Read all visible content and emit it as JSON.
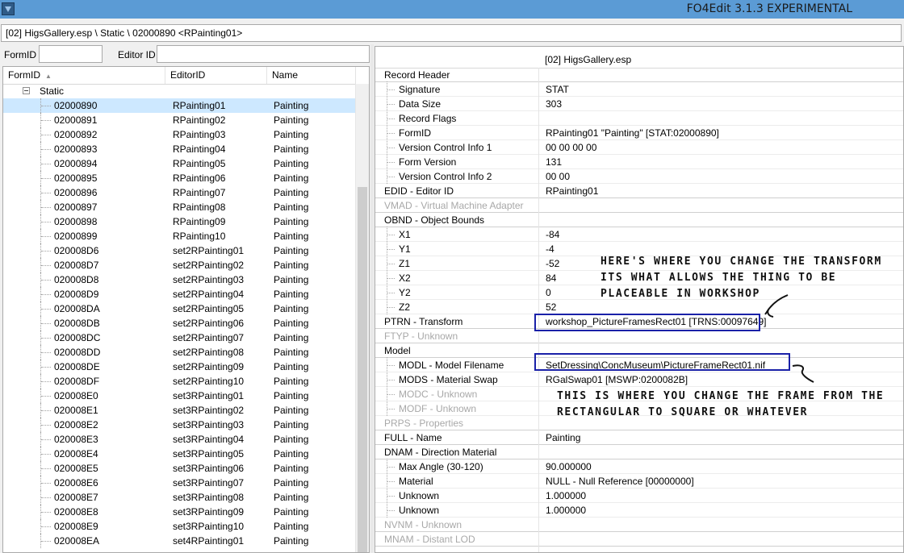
{
  "window": {
    "title": "FO4Edit 3.1.3 EXPERIMENTAL"
  },
  "path": "[02] HigsGallery.esp \\ Static \\ 02000890 <RPainting01>",
  "filter": {
    "formid_label": "FormID",
    "formid_value": "",
    "editorid_label": "Editor ID",
    "editorid_value": ""
  },
  "list": {
    "columns": [
      "FormID",
      "EditorID",
      "Name"
    ],
    "group": "Static",
    "rows": [
      [
        "02000890",
        "RPainting01",
        "Painting"
      ],
      [
        "02000891",
        "RPainting02",
        "Painting"
      ],
      [
        "02000892",
        "RPainting03",
        "Painting"
      ],
      [
        "02000893",
        "RPainting04",
        "Painting"
      ],
      [
        "02000894",
        "RPainting05",
        "Painting"
      ],
      [
        "02000895",
        "RPainting06",
        "Painting"
      ],
      [
        "02000896",
        "RPainting07",
        "Painting"
      ],
      [
        "02000897",
        "RPainting08",
        "Painting"
      ],
      [
        "02000898",
        "RPainting09",
        "Painting"
      ],
      [
        "02000899",
        "RPainting10",
        "Painting"
      ],
      [
        "020008D6",
        "set2RPainting01",
        "Painting"
      ],
      [
        "020008D7",
        "set2RPainting02",
        "Painting"
      ],
      [
        "020008D8",
        "set2RPainting03",
        "Painting"
      ],
      [
        "020008D9",
        "set2RPainting04",
        "Painting"
      ],
      [
        "020008DA",
        "set2RPainting05",
        "Painting"
      ],
      [
        "020008DB",
        "set2RPainting06",
        "Painting"
      ],
      [
        "020008DC",
        "set2RPainting07",
        "Painting"
      ],
      [
        "020008DD",
        "set2RPainting08",
        "Painting"
      ],
      [
        "020008DE",
        "set2RPainting09",
        "Painting"
      ],
      [
        "020008DF",
        "set2RPainting10",
        "Painting"
      ],
      [
        "020008E0",
        "set3RPainting01",
        "Painting"
      ],
      [
        "020008E1",
        "set3RPainting02",
        "Painting"
      ],
      [
        "020008E2",
        "set3RPainting03",
        "Painting"
      ],
      [
        "020008E3",
        "set3RPainting04",
        "Painting"
      ],
      [
        "020008E4",
        "set3RPainting05",
        "Painting"
      ],
      [
        "020008E5",
        "set3RPainting06",
        "Painting"
      ],
      [
        "020008E6",
        "set3RPainting07",
        "Painting"
      ],
      [
        "020008E7",
        "set3RPainting08",
        "Painting"
      ],
      [
        "020008E8",
        "set3RPainting09",
        "Painting"
      ],
      [
        "020008E9",
        "set3RPainting10",
        "Painting"
      ],
      [
        "020008EA",
        "set4RPainting01",
        "Painting"
      ]
    ]
  },
  "record": {
    "file_header": "[02] HigsGallery.esp",
    "rows": [
      {
        "label": "Record Header",
        "value": "",
        "indent": 0,
        "disabled": false
      },
      {
        "label": "Signature",
        "value": "STAT",
        "indent": 1,
        "disabled": false
      },
      {
        "label": "Data Size",
        "value": "303",
        "indent": 1,
        "disabled": false
      },
      {
        "label": "Record Flags",
        "value": "",
        "indent": 1,
        "disabled": false
      },
      {
        "label": "FormID",
        "value": "RPainting01 \"Painting\" [STAT:02000890]",
        "indent": 1,
        "disabled": false
      },
      {
        "label": "Version Control Info 1",
        "value": "00 00 00 00",
        "indent": 1,
        "disabled": false
      },
      {
        "label": "Form Version",
        "value": "131",
        "indent": 1,
        "disabled": false
      },
      {
        "label": "Version Control Info 2",
        "value": "00 00",
        "indent": 1,
        "disabled": false
      },
      {
        "label": "EDID - Editor ID",
        "value": "RPainting01",
        "indent": 0,
        "disabled": false
      },
      {
        "label": "VMAD - Virtual Machine Adapter",
        "value": "",
        "indent": 0,
        "disabled": true
      },
      {
        "label": "OBND - Object Bounds",
        "value": "",
        "indent": 0,
        "disabled": false
      },
      {
        "label": "X1",
        "value": "-84",
        "indent": 1,
        "disabled": false
      },
      {
        "label": "Y1",
        "value": "-4",
        "indent": 1,
        "disabled": false
      },
      {
        "label": "Z1",
        "value": "-52",
        "indent": 1,
        "disabled": false
      },
      {
        "label": "X2",
        "value": "84",
        "indent": 1,
        "disabled": false
      },
      {
        "label": "Y2",
        "value": "0",
        "indent": 1,
        "disabled": false
      },
      {
        "label": "Z2",
        "value": "52",
        "indent": 1,
        "disabled": false
      },
      {
        "label": "PTRN - Transform",
        "value": "workshop_PictureFramesRect01 [TRNS:00097649]",
        "indent": 0,
        "disabled": false
      },
      {
        "label": "FTYP - Unknown",
        "value": "",
        "indent": 0,
        "disabled": true
      },
      {
        "label": "Model",
        "value": "",
        "indent": 0,
        "disabled": false
      },
      {
        "label": "MODL - Model Filename",
        "value": "SetDressing\\ConcMuseum\\PictureFrameRect01.nif",
        "indent": 1,
        "disabled": false
      },
      {
        "label": "MODS - Material Swap",
        "value": "RGalSwap01 [MSWP:0200082B]",
        "indent": 1,
        "disabled": false
      },
      {
        "label": "MODC - Unknown",
        "value": "",
        "indent": 1,
        "disabled": true
      },
      {
        "label": "MODF - Unknown",
        "value": "",
        "indent": 1,
        "disabled": true
      },
      {
        "label": "PRPS - Properties",
        "value": "",
        "indent": 0,
        "disabled": true
      },
      {
        "label": "FULL - Name",
        "value": "Painting",
        "indent": 0,
        "disabled": false
      },
      {
        "label": "DNAM - Direction Material",
        "value": "",
        "indent": 0,
        "disabled": false
      },
      {
        "label": "Max Angle (30-120)",
        "value": "90.000000",
        "indent": 1,
        "disabled": false
      },
      {
        "label": "Material",
        "value": "NULL - Null Reference [00000000]",
        "indent": 1,
        "disabled": false
      },
      {
        "label": "Unknown",
        "value": "1.000000",
        "indent": 1,
        "disabled": false
      },
      {
        "label": "Unknown",
        "value": "1.000000",
        "indent": 1,
        "disabled": false
      },
      {
        "label": "NVNM - Unknown",
        "value": "",
        "indent": 0,
        "disabled": true
      },
      {
        "label": "MNAM - Distant LOD",
        "value": "",
        "indent": 0,
        "disabled": true
      }
    ]
  },
  "annotations": {
    "transform_note": [
      "HERE'S WHERE YOU CHANGE THE TRANSFORM",
      "ITS WHAT ALLOWS THE THING TO BE",
      "PLACEABLE IN WORKSHOP"
    ],
    "frame_note": [
      "THIS IS WHERE YOU CHANGE THE FRAME FROM THE",
      "RECTANGULAR TO SQUARE OR WHATEVER"
    ],
    "highlight_color": "#1a21a8"
  },
  "colors": {
    "titlebar": "#5b9bd5",
    "selected_row": "#cde8ff"
  }
}
